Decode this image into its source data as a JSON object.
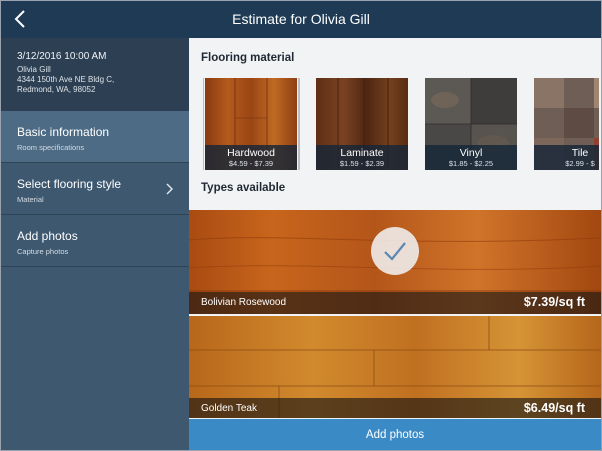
{
  "header": {
    "title": "Estimate for Olivia Gill",
    "back_icon": "back-chevron-icon"
  },
  "customer": {
    "datetime": "3/12/2016 10:00 AM",
    "name": "Olivia Gill",
    "address_line1": "4344 150th Ave NE Bldg C,",
    "address_line2": "Redmond, WA, 98052"
  },
  "nav": [
    {
      "title": "Basic information",
      "subtitle": "Room specifications",
      "active": true
    },
    {
      "title": "Select flooring style",
      "subtitle": "Material",
      "active": false,
      "icon": "chevron-right-icon"
    },
    {
      "title": "Add photos",
      "subtitle": "Capture photos",
      "active": false
    }
  ],
  "main": {
    "flooring_title": "Flooring material",
    "types_title": "Types available",
    "materials": [
      {
        "name": "Hardwood",
        "price": "$4.59 - $7.39",
        "selected": true
      },
      {
        "name": "Laminate",
        "price": "$1.59 - $2.39",
        "selected": false
      },
      {
        "name": "Vinyl",
        "price": "$1.85 - $2.25",
        "selected": false
      },
      {
        "name": "Tile",
        "price": "$2.99 - $",
        "selected": false
      }
    ],
    "types": [
      {
        "name": "Bolivian Rosewood",
        "price": "$7.39/sq ft",
        "selected": true
      },
      {
        "name": "Golden Teak",
        "price": "$6.49/sq ft",
        "selected": false
      }
    ],
    "cta_label": "Add photos"
  },
  "colors": {
    "header_bg": "#1e3a55",
    "sidebar_bg": "#3e5870",
    "sidebar_active": "#4d6b85",
    "cta_bg": "#3a8ac6"
  }
}
